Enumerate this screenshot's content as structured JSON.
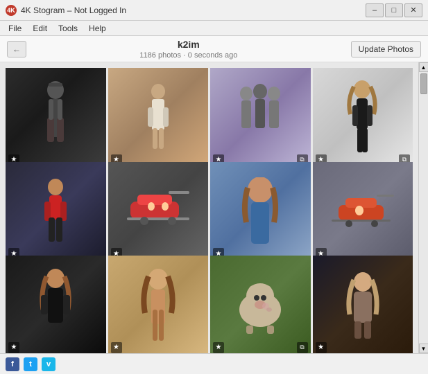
{
  "window": {
    "title": "4K Stogram – Not Logged In",
    "icon": "4K"
  },
  "title_controls": {
    "minimize": "–",
    "maximize": "□",
    "close": "✕"
  },
  "menu": {
    "items": [
      "File",
      "Edit",
      "Tools",
      "Help"
    ]
  },
  "toolbar": {
    "back_label": "←",
    "profile_name": "k2im",
    "profile_meta": "1186 photos · 0 seconds ago",
    "update_button": "Update Photos"
  },
  "photos": [
    {
      "id": 1,
      "color_class": "p1",
      "has_star": true,
      "has_gallery": false
    },
    {
      "id": 2,
      "color_class": "p2",
      "has_star": true,
      "has_gallery": false
    },
    {
      "id": 3,
      "color_class": "p3",
      "has_star": true,
      "has_gallery": true
    },
    {
      "id": 4,
      "color_class": "p4",
      "has_star": true,
      "has_gallery": true
    },
    {
      "id": 5,
      "color_class": "p5",
      "has_star": true,
      "has_gallery": false
    },
    {
      "id": 6,
      "color_class": "p6",
      "has_star": true,
      "has_gallery": false
    },
    {
      "id": 7,
      "color_class": "p7",
      "has_star": true,
      "has_gallery": false
    },
    {
      "id": 8,
      "color_class": "p8",
      "has_star": true,
      "has_gallery": false
    },
    {
      "id": 9,
      "color_class": "p9",
      "has_star": true,
      "has_gallery": false
    },
    {
      "id": 10,
      "color_class": "p10",
      "has_star": true,
      "has_gallery": false
    },
    {
      "id": 11,
      "color_class": "p11",
      "has_star": true,
      "has_gallery": true
    },
    {
      "id": 12,
      "color_class": "p12",
      "has_star": true,
      "has_gallery": false
    }
  ],
  "status_bar": {
    "social_icons": [
      "f",
      "t",
      "v"
    ]
  },
  "icons": {
    "star": "★",
    "gallery": "⧉",
    "back": "◀",
    "scroll_up": "▲",
    "scroll_down": "▼"
  }
}
